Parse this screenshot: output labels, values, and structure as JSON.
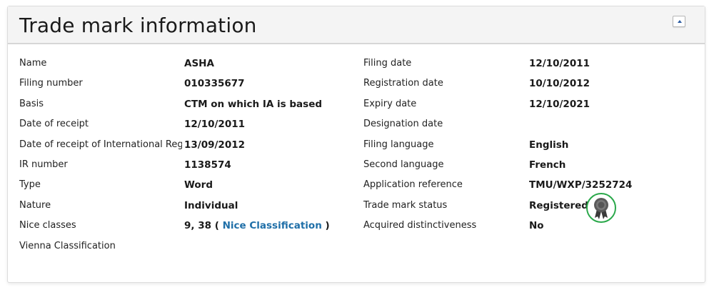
{
  "header": {
    "title": "Trade mark information"
  },
  "left_fields": [
    {
      "label": "Name",
      "value": "ASHA"
    },
    {
      "label": "Filing number",
      "value": "010335677"
    },
    {
      "label": "Basis",
      "value": "CTM on which IA is based"
    },
    {
      "label": "Date of receipt",
      "value": "12/10/2011"
    },
    {
      "label": "Date of receipt of International Registration",
      "value": "13/09/2012"
    },
    {
      "label": "IR number",
      "value": "1138574"
    },
    {
      "label": "Type",
      "value": "Word"
    },
    {
      "label": "Nature",
      "value": "Individual"
    },
    {
      "label": "Nice classes",
      "value": "9, 38 (",
      "link": "Nice Classification",
      "suffix": ")"
    },
    {
      "label": "Vienna Classification",
      "value": ""
    }
  ],
  "right_fields": [
    {
      "label": "Filing date",
      "value": "12/10/2011"
    },
    {
      "label": "Registration date",
      "value": "10/10/2012"
    },
    {
      "label": "Expiry date",
      "value": "12/10/2021"
    },
    {
      "label": "Designation date",
      "value": ""
    },
    {
      "label": "Filing language",
      "value": "English"
    },
    {
      "label": "Second language",
      "value": "French"
    },
    {
      "label": "Application reference",
      "value": "TMU/WXP/3252724"
    },
    {
      "label": "Trade mark status",
      "value": "Registered",
      "icon": "registered-ribbon-icon"
    },
    {
      "label": "Acquired distinctiveness",
      "value": "No"
    }
  ],
  "colors": {
    "link": "#1f6fa8",
    "badge_ring": "#2aa84a",
    "ribbon": "#444444"
  }
}
